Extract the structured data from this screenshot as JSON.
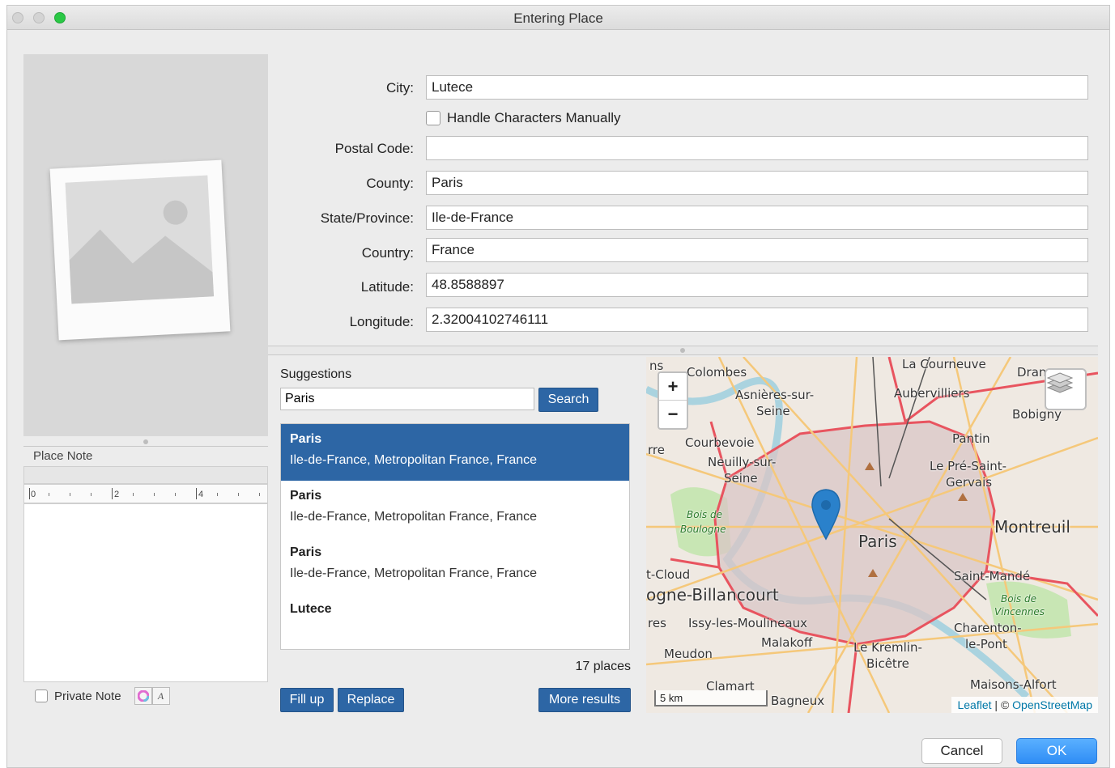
{
  "window": {
    "title": "Entering Place"
  },
  "form": {
    "city_label": "City:",
    "city_value": "Lutece",
    "handle_chars_label": "Handle Characters Manually",
    "postal_label": "Postal Code:",
    "postal_value": "",
    "county_label": "County:",
    "county_value": "Paris",
    "state_label": "State/Province:",
    "state_value": "Ile-de-France",
    "country_label": "Country:",
    "country_value": "France",
    "latitude_label": "Latitude:",
    "latitude_value": "48.8588897",
    "longitude_label": "Longitude:",
    "longitude_value": "2.32004102746111"
  },
  "note": {
    "header": "Place Note",
    "ruler": [
      "0",
      "2",
      "4"
    ],
    "private_label": "Private Note",
    "format_glyph": "A"
  },
  "suggestions": {
    "title": "Suggestions",
    "query": "Paris",
    "search_label": "Search",
    "items": [
      {
        "name": "Paris",
        "detail": "Ile-de-France, Metropolitan France, France",
        "selected": true
      },
      {
        "name": "Paris",
        "detail": "Ile-de-France, Metropolitan France, France",
        "selected": false
      },
      {
        "name": "Paris",
        "detail": "Ile-de-France, Metropolitan France, France",
        "selected": false
      },
      {
        "name": "Lutece",
        "detail": "",
        "selected": false
      }
    ],
    "count": "17 places",
    "fill_up_label": "Fill up",
    "replace_label": "Replace",
    "more_label": "More results"
  },
  "map": {
    "zoom_in": "+",
    "zoom_out": "−",
    "scale": "5 km",
    "attrib_leaflet": "Leaflet",
    "attrib_sep": " | © ",
    "attrib_osm": "OpenStreetMap",
    "labels": {
      "colombes": "Colombes",
      "asnieres": "Asnières-sur-",
      "seine1": "Seine",
      "la_courneuve": "La Courneuve",
      "aubervilliers": "Aubervilliers",
      "drancy": "Dran",
      "bobigny": "Bobigny",
      "pantin": "Pantin",
      "courbevoie": "Courbevoie",
      "neuilly": "Neuilly-sur-",
      "seine2": "Seine",
      "pre_st_gervais1": "Le Pré-Saint-",
      "pre_st_gervais2": "Gervais",
      "bois_boulogne1": "Bois de",
      "bois_boulogne2": "Boulogne",
      "paris": "Paris",
      "montreuil": "Montreuil",
      "st_cloud": "t-Cloud",
      "boulogne_bill": "ogne-Billancourt",
      "saint_mande": "Saint-Mandé",
      "bois_vincennes1": "Bois de",
      "bois_vincennes2": "Vincennes",
      "issy": "Issy-les-Moulineaux",
      "charenton1": "Charenton-",
      "charenton2": "le-Pont",
      "malakoff": "Malakoff",
      "kremlin1": "Le Kremlin-",
      "kremlin2": "Bicêtre",
      "meudon": "Meudon",
      "clamart": "Clamart",
      "bagneux": "Bagneux",
      "maisons_alfort": "Maisons-Alfort",
      "rre": "rre",
      "res": "res",
      "ns": "ns"
    }
  },
  "footer": {
    "cancel_label": "Cancel",
    "ok_label": "OK"
  },
  "colors": {
    "accent": "#2d66a5",
    "ok_button": "#2f8df5",
    "boundary": "#e8545f"
  }
}
